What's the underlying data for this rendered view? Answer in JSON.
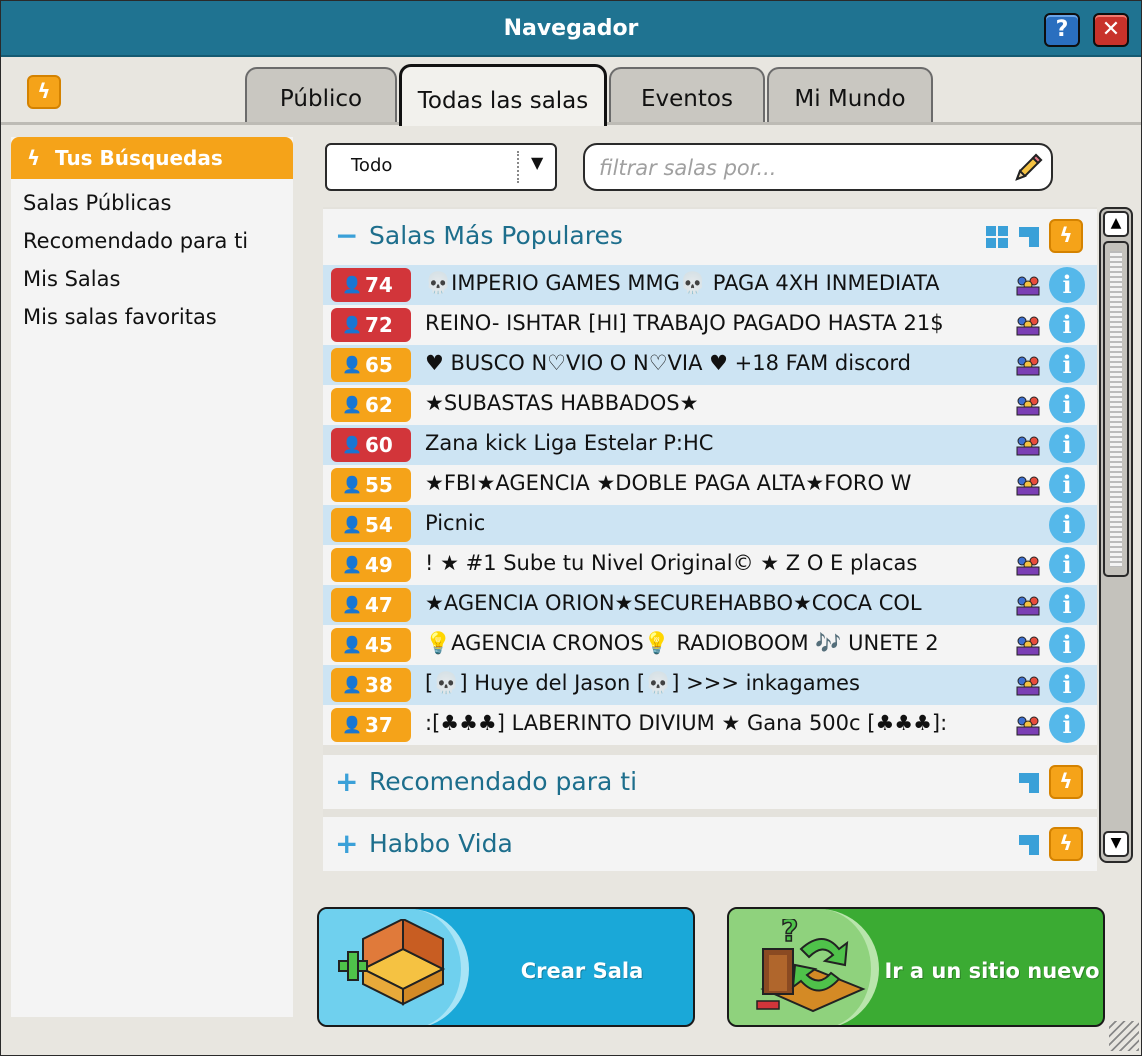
{
  "window": {
    "title": "Navegador",
    "help_label": "?",
    "close_label": "✕"
  },
  "tabs": [
    {
      "label": "Público"
    },
    {
      "label": "Todas las salas"
    },
    {
      "label": "Eventos"
    },
    {
      "label": "Mi Mundo"
    }
  ],
  "sidebar": {
    "header": "Tus Búsquedas",
    "items": [
      {
        "label": "Salas Públicas"
      },
      {
        "label": "Recomendado para ti"
      },
      {
        "label": "Mis Salas"
      },
      {
        "label": "Mis salas favoritas"
      }
    ]
  },
  "filter": {
    "dropdown_value": "Todo",
    "placeholder": "filtrar salas por..."
  },
  "sections": [
    {
      "label": "Salas Más Populares",
      "sign": "−"
    },
    {
      "label": "Recomendado para ti",
      "sign": "+"
    },
    {
      "label": "Habbo Vida",
      "sign": "+"
    }
  ],
  "rooms": [
    {
      "count": "74",
      "name": "💀IMPERIO GAMES MMG💀 PAGA 4XH INMEDIATA",
      "status": "red"
    },
    {
      "count": "72",
      "name": "REINO- ISHTAR [HI] TRABAJO PAGADO HASTA 21$",
      "status": "red"
    },
    {
      "count": "65",
      "name": "♥ BUSCO N♡VIO O N♡VIA ♥ +18  FAM    discord",
      "status": "orange"
    },
    {
      "count": "62",
      "name": "★SUBASTAS HABBADOS★",
      "status": "orange"
    },
    {
      "count": "60",
      "name": "Zana kick Liga Estelar P:HC",
      "status": "red"
    },
    {
      "count": "55",
      "name": "★FBI★AGENCIA ★DOBLE PAGA ALTA★FORO W",
      "status": "orange"
    },
    {
      "count": "54",
      "name": "Picnic",
      "status": "orange"
    },
    {
      "count": "49",
      "name": "!   ★  #1 Sube tu Nivel Original©  ★  Z O E   placas",
      "status": "orange"
    },
    {
      "count": "47",
      "name": "★AGENCIA ORION★SECUREHABBO★COCA COL",
      "status": "orange"
    },
    {
      "count": "45",
      "name": "💡AGENCIA CRONOS💡 RADIOBOOM 🎶 UNETE 2",
      "status": "orange"
    },
    {
      "count": "38",
      "name": "[💀] Huye del Jason [💀] >>> inkagames",
      "status": "orange"
    },
    {
      "count": "37",
      "name": ":[♣♣♣] LABERINTO DIVIUM ★ Gana 500c [♣♣♣]:",
      "status": "orange"
    }
  ],
  "buttons": {
    "create_room": "Crear Sala",
    "go_random": "Ir a un sitio nuevo"
  },
  "colors": {
    "titlebar": "#1f7391",
    "accent_orange": "#f5a319",
    "badge_red": "#d2353a",
    "row_highlight": "#cde4f3",
    "section_text": "#1d6e8c",
    "create_blue": "#1aa8d8",
    "go_green": "#3bab33"
  },
  "icons": {
    "top": "lightning-icon",
    "pencil": "pencil-icon",
    "info": "info-icon",
    "group": "group-icon",
    "user": "user-icon"
  }
}
